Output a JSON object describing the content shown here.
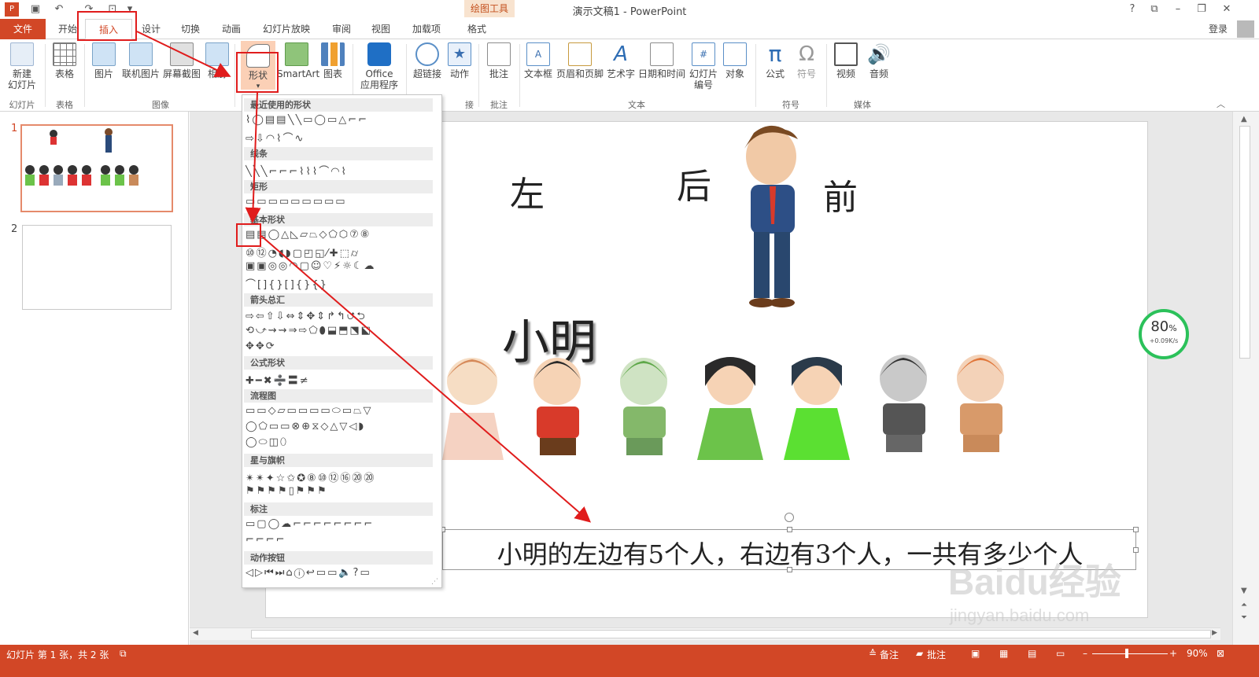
{
  "app": {
    "window_title": "演示文稿1 - PowerPoint",
    "contextual_tab_group": "绘图工具",
    "signin_label": "登录",
    "help_btn": "?",
    "restore_btn": "⧉",
    "minimize_btn": "–",
    "maximize_btn": "❐",
    "close_btn": "✕"
  },
  "tabs": [
    {
      "label": "文件"
    },
    {
      "label": "开始"
    },
    {
      "label": "插入"
    },
    {
      "label": "设计"
    },
    {
      "label": "切换"
    },
    {
      "label": "动画"
    },
    {
      "label": "幻灯片放映"
    },
    {
      "label": "审阅"
    },
    {
      "label": "视图"
    },
    {
      "label": "加载项"
    },
    {
      "label": "格式"
    }
  ],
  "ribbon": {
    "buttons": {
      "new_slide": [
        "新建",
        "幻灯片"
      ],
      "table": "表格",
      "picture": "图片",
      "online_picture": "联机图片",
      "screenshot": "屏幕截图",
      "album": "相册",
      "shapes": "形状",
      "smartart": "SmartArt",
      "chart": "图表",
      "office_apps": [
        "Office",
        "应用程序"
      ],
      "hyperlink": "超链接",
      "action": "动作",
      "comment": "批注",
      "textbox": "文本框",
      "header_footer": "页眉和页脚",
      "wordart": "艺术字",
      "datetime": "日期和时间",
      "slide_number": [
        "幻灯片",
        "编号"
      ],
      "object": "对象",
      "equation": "公式",
      "symbol": "符号",
      "video": "视频",
      "audio": "音频"
    },
    "groups": {
      "slides": "幻灯片",
      "tables": "表格",
      "images": "图像",
      "links": "接",
      "comments": "批注",
      "text": "文本",
      "symbols": "符号",
      "media": "媒体"
    }
  },
  "shapes_gallery": {
    "sections": [
      {
        "title": "最近使用的形状",
        "rows": [
          "⌇◯▤▤╲╲▭◯▭△⌐⌐",
          "⇨⇩◠⌇⌒∿"
        ]
      },
      {
        "title": "线条",
        "rows": [
          "╲╲╲⌐⌐⌐⌇⌇⌇⌒◠⌇"
        ]
      },
      {
        "title": "矩形",
        "rows": [
          "▭▭▭▭▭▭▭▭▭"
        ]
      },
      {
        "title": "基本形状",
        "rows": [
          "▤▤◯△◺▱⏢◇⬠⬡⑦⑧",
          "⑩⑫◔◖◗▢◰◱⁄✚⬚⌭",
          "▣▣◎◎◠▢☺♡⚡☼☾☁",
          "⌒[]{}[]{}{}"
        ]
      },
      {
        "title": "箭头总汇",
        "rows": [
          "⇨⇦⇧⇩⇔⇕✥⇕↱↰⮍⮌",
          "⟲⤻⇝⇝⇒⇨⬠⬮⬓⬒⬔⬕",
          "✥✥⟳"
        ]
      },
      {
        "title": "公式形状",
        "rows": [
          "✚━✖➗〓≠"
        ]
      },
      {
        "title": "流程图",
        "rows": [
          "▭▭◇▱▭▭▭▭⬭▭⏢▽",
          "◯⬠▭▭⊗⊕⧖◇△▽◁◗",
          "◯⬭◫⬯"
        ]
      },
      {
        "title": "星与旗帜",
        "rows": [
          "✴✴✦☆✩✪⑧⑩⑫⑯⑳⑳",
          "⚑⚑⚑⚑▯⚑⚑⚑"
        ]
      },
      {
        "title": "标注",
        "rows": [
          "▭▢◯☁⌐⌐⌐⌐⌐⌐⌐⌐",
          "⌐⌐⌐⌐"
        ]
      },
      {
        "title": "动作按钮",
        "rows": [
          "◁▷⏮⏭⌂ⓘ↩▭▭🔈?▭"
        ]
      }
    ]
  },
  "slides": [
    {
      "number": "1"
    },
    {
      "number": "2"
    }
  ],
  "slide": {
    "label_left": "左",
    "label_back": "后",
    "label_front": "前",
    "name": "小明",
    "question": "小明的左边有5个人，右边有3个人，一共有多少个人"
  },
  "status_bar": {
    "slide_info": "幻灯片 第 1 张，共 2 张",
    "notes": "备注",
    "comments": "批注",
    "zoom": "90%"
  },
  "net_widget": {
    "percent": "80",
    "percent_sign": "%",
    "speed": "+0.09K/s"
  },
  "watermark": {
    "brand": "Baidu经验",
    "url": "jingyan.baidu.com"
  },
  "colors": {
    "accent": "#d24726",
    "annotation_red": "#e01c1c",
    "contextual_bg": "#f8e3cf",
    "widget_green": "#2bc15a"
  }
}
